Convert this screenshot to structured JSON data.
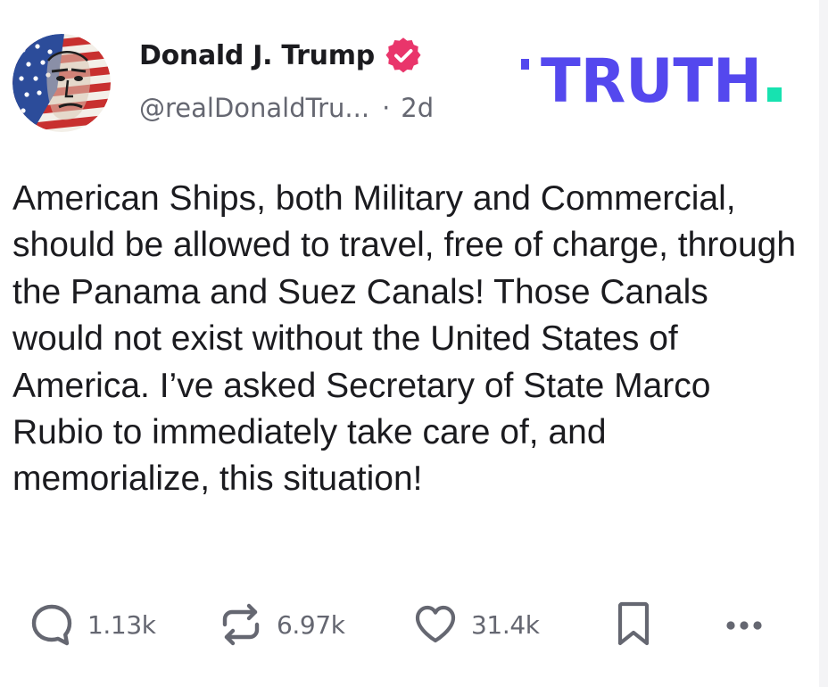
{
  "post": {
    "author": {
      "display_name": "Donald J. Trump",
      "handle": "@realDonaldTru...",
      "verified": true,
      "verified_color": "#e9356b"
    },
    "separator": "·",
    "age": "2d",
    "text": "American Ships, both Military and Commercial, should be allowed to travel, free of charge, through the Panama and Suez Canals! Those Canals would not exist without the United States of America. I’ve asked Secretary of State Marco Rubio to immediately take care of, and memorialize, this situation!"
  },
  "brand": {
    "wordmark": "TRUTH",
    "wordmark_color": "#5448ee",
    "dot_color": "#17e2b0"
  },
  "actions": {
    "replies": "1.13k",
    "retruths": "6.97k",
    "likes": "31.4k"
  },
  "icons": [
    "verified-badge-icon",
    "reply-icon",
    "retruth-icon",
    "like-icon",
    "bookmark-icon",
    "more-icon"
  ]
}
